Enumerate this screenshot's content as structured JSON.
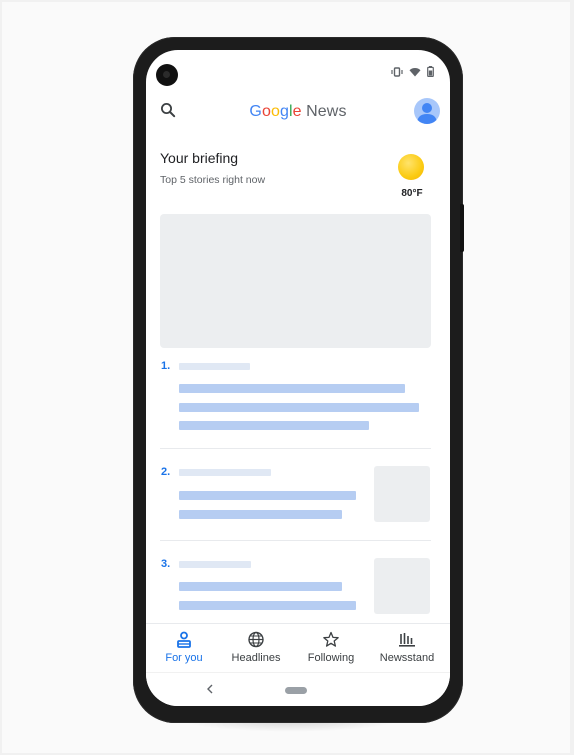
{
  "app": {
    "logo_google": "Google",
    "logo_news": "News",
    "logo_colors": [
      "#4285F4",
      "#EA4335",
      "#FBBC05",
      "#4285F4",
      "#34A853",
      "#EA4335"
    ]
  },
  "briefing": {
    "title": "Your briefing",
    "subtitle": "Top 5 stories right now",
    "weather_icon": "sun-icon",
    "temperature": "80°F"
  },
  "stories": [
    {
      "number": "1."
    },
    {
      "number": "2."
    },
    {
      "number": "3."
    }
  ],
  "bottom_nav": {
    "items": [
      {
        "label": "For you",
        "icon": "for-you-icon",
        "active": true
      },
      {
        "label": "Headlines",
        "icon": "globe-icon",
        "active": false
      },
      {
        "label": "Following",
        "icon": "star-icon",
        "active": false
      },
      {
        "label": "Newsstand",
        "icon": "newsstand-icon",
        "active": false
      }
    ]
  },
  "colors": {
    "accent": "#1a73e8",
    "placeholder_blue": "#b6cdf2",
    "placeholder_grey": "#eceef0"
  }
}
